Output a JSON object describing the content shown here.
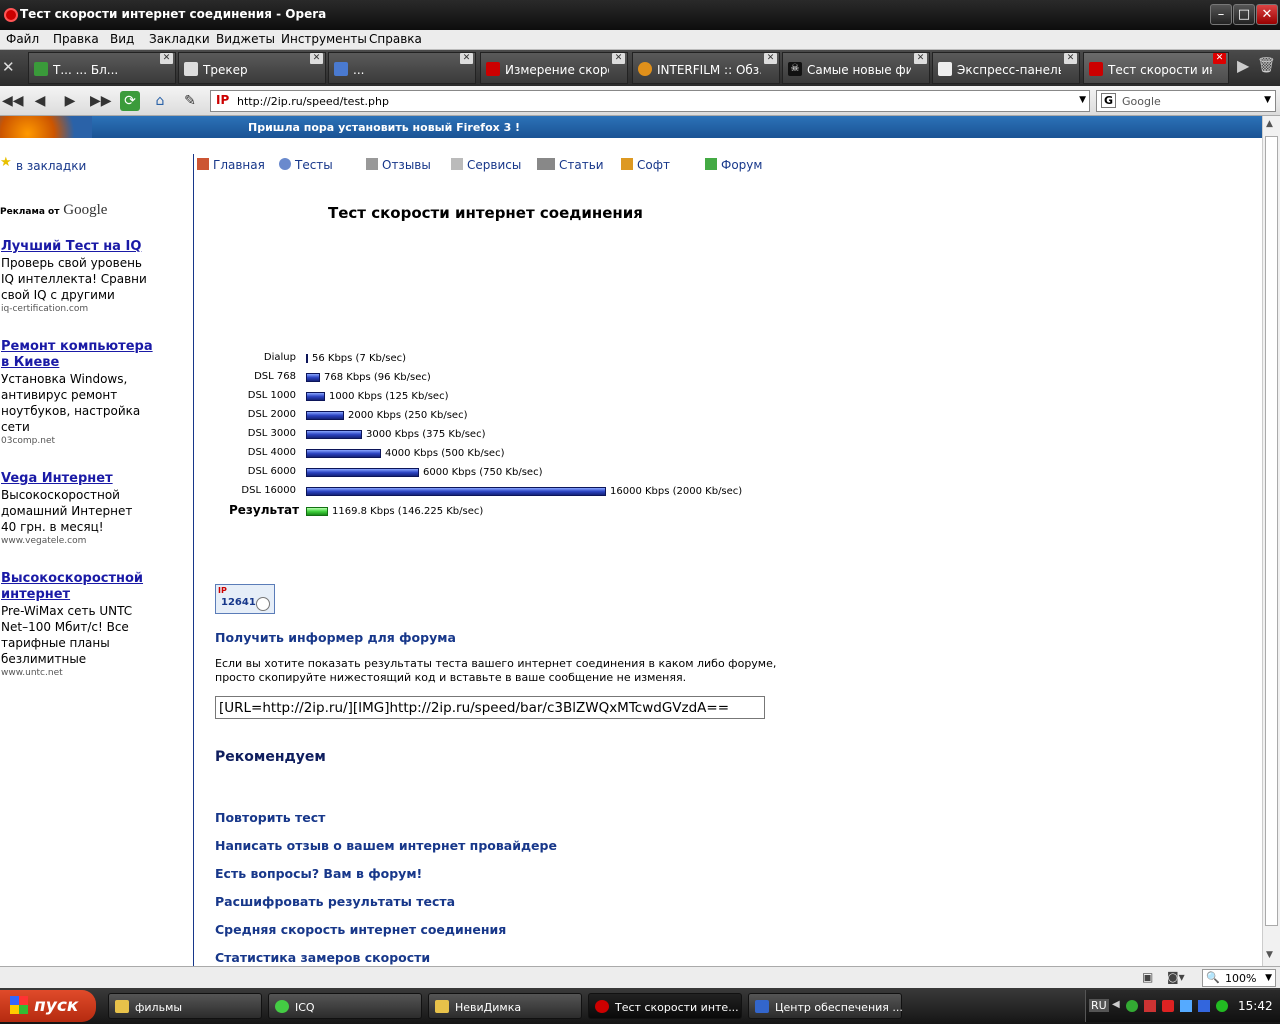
{
  "window": {
    "title": "Тест скорости интернет соединения - Opera"
  },
  "menu": [
    "Файл",
    "Правка",
    "Вид",
    "Закладки",
    "Виджеты",
    "Инструменты",
    "Справка"
  ],
  "tabs": [
    {
      "label": "Т...  ... Бл..."
    },
    {
      "label": "Трекер"
    },
    {
      "label": "..."
    },
    {
      "label": "Измерение скоро..."
    },
    {
      "label": "INTERFILM :: Обз..."
    },
    {
      "label": "Самые новые фи..."
    },
    {
      "label": "Экспресс-панель"
    },
    {
      "label": "Тест скорости ин..."
    }
  ],
  "address": {
    "ip_logo": "IP",
    "url": "http://2ip.ru/speed/test.php"
  },
  "search": {
    "engine_icon": "G",
    "placeholder": "Google"
  },
  "banner": {
    "text": "Пришла пора установить новый Firefox 3 !"
  },
  "sidebar": {
    "bookmark": "в закладки",
    "ads_label": "Реклама от",
    "ads_brand": "Google",
    "ads": [
      {
        "title": "Лучший Тест на IQ",
        "text": "Проверь свой уровень IQ интеллекта! Сравни свой IQ с другими",
        "url": "iq-certification.com"
      },
      {
        "title": "Ремонт компьютера в Киеве",
        "text": "Установка Windows, антивирус ремонт ноутбуков, настройка сети",
        "url": "03comp.net"
      },
      {
        "title": "Vega Интернет",
        "text": "Высокоскоростной домашний Интернет 40 грн. в месяц!",
        "url": "www.vegatele.com"
      },
      {
        "title": "Высокоскоростной интернет",
        "text": "Pre-WiMax сеть UNTC Net–100 Мбит/с! Все тарифные планы безлимитные",
        "url": "www.untc.net"
      }
    ]
  },
  "site_nav": [
    "Главная",
    "Тесты",
    "Отзывы",
    "Сервисы",
    "Статьи",
    "Софт",
    "Форум"
  ],
  "main": {
    "title": "Тест скорости интернет соединения",
    "result_label": "Результат",
    "informer_badge_ip": "IP",
    "informer_badge_num": "12641",
    "informer_title": "Получить информер для форума",
    "informer_text": "Если вы хотите показать результаты теста вашего интернет соединения в каком либо форуме, просто скопируйте нижестоящий код и вставьте в ваше сообщение не изменяя.",
    "informer_code": "[URL=http://2ip.ru/][IMG]http://2ip.ru/speed/bar/c3BlZWQxMTcwdGVzdA==",
    "recommend_title": "Рекомендуем",
    "links": [
      "Повторить тест",
      "Написать отзыв о вашем интернет провайдере",
      "Есть вопросы? Вам в форум!",
      "Расшифровать результаты теста",
      "Средняя скорость интернет соединения",
      "Статистика замеров скорости"
    ]
  },
  "chart_data": {
    "type": "bar",
    "orientation": "horizontal",
    "unit": "Kbps",
    "categories": [
      "Dialup",
      "DSL 768",
      "DSL 1000",
      "DSL 2000",
      "DSL 3000",
      "DSL 4000",
      "DSL 6000",
      "DSL 16000",
      "Результат"
    ],
    "values": [
      56,
      768,
      1000,
      2000,
      3000,
      4000,
      6000,
      16000,
      1169.8
    ],
    "labels": [
      "56 Kbps (7 Kb/sec)",
      "768 Kbps (96 Kb/sec)",
      "1000 Kbps (125 Kb/sec)",
      "2000 Kbps (250 Kb/sec)",
      "3000 Kbps (375 Kb/sec)",
      "4000 Kbps (500 Kb/sec)",
      "6000 Kbps (750 Kb/sec)",
      "16000 Kbps (2000 Kb/sec)",
      "1169.8 Kbps (146.225 Kb/sec)"
    ],
    "colors": {
      "reference": "#2b43c2",
      "result": "#3fd13c"
    }
  },
  "status": {
    "zoom": "100%"
  },
  "taskbar": {
    "start": "пуск",
    "items": [
      "фильмы",
      "ICQ",
      "НевиДимка",
      "Тест скорости инте...",
      "Центр обеспечения ..."
    ],
    "lang": "RU",
    "clock": "15:42"
  }
}
